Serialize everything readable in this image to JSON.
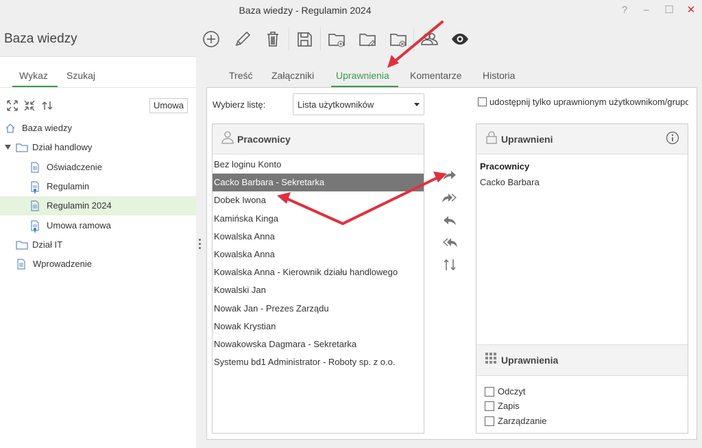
{
  "window": {
    "title": "Baza wiedzy - Regulamin 2024",
    "help": "?",
    "minimize": "–",
    "maximize": "☐",
    "close": "✕"
  },
  "app_title": "Baza wiedzy",
  "left_tabs": [
    "Wykaz",
    "Szukaj"
  ],
  "filter_value": "Umowa",
  "tree": [
    {
      "label": "Baza wiedzy",
      "icon": "home-icon",
      "level": 0
    },
    {
      "label": "Dział handlowy",
      "icon": "folder-icon",
      "level": 0,
      "expanded": true
    },
    {
      "label": "Oświadczenie",
      "icon": "document-icon",
      "level": 1
    },
    {
      "label": "Regulamin",
      "icon": "document-pin-icon",
      "level": 1
    },
    {
      "label": "Regulamin 2024",
      "icon": "document-icon",
      "level": 1,
      "selected": true
    },
    {
      "label": "Umowa ramowa",
      "icon": "document-pin-icon",
      "level": 1
    },
    {
      "label": "Dział IT",
      "icon": "folder-icon",
      "level": 0
    },
    {
      "label": "Wprowadzenie",
      "icon": "document-icon",
      "level": 0
    }
  ],
  "toolbar": [
    "add-icon",
    "edit-icon",
    "delete-icon",
    "save-icon",
    "new-folder-icon",
    "edit-folder-icon",
    "delete-folder-icon",
    "users-icon",
    "eye-icon"
  ],
  "main_tabs": [
    "Treść",
    "Załączniki",
    "Uprawnienia",
    "Komentarze",
    "Historia"
  ],
  "active_tab": "Uprawnienia",
  "list_select": {
    "label": "Wybierz listę:",
    "value": "Lista użytkowników"
  },
  "share_only": {
    "label": "udostępnij tylko uprawnionym użytkownikom/grupom",
    "checked": false
  },
  "employees": {
    "title": "Pracownicy",
    "items": [
      "Bez loginu Konto",
      "Cacko Barbara - Sekretarka",
      "Dobek Iwona",
      "Kamińska Kinga",
      "Kowalska Anna",
      "Kowalska Anna",
      "Kowalska Anna - Kierownik działu handlowego",
      "Kowalski Jan",
      "Nowak Jan - Prezes Zarządu",
      "Nowak Krystian",
      "Nowakowska Dagmara - Sekretarka",
      "Systemu bd1 Administrator - Roboty sp. z o.o."
    ],
    "selected_index": 1
  },
  "authorized": {
    "title": "Uprawnieni",
    "group": "Pracownicy",
    "users": [
      "Cacko Barbara"
    ]
  },
  "permissions": {
    "title": "Uprawnienia",
    "items": [
      {
        "label": "Odczyt",
        "checked": false
      },
      {
        "label": "Zapis",
        "checked": false
      },
      {
        "label": "Zarządzanie",
        "checked": false
      }
    ]
  },
  "colors": {
    "accent": "#3a9a4b",
    "selected_row": "#777777",
    "selected_tree": "#e6f3df",
    "arrow": "#e0303f"
  }
}
